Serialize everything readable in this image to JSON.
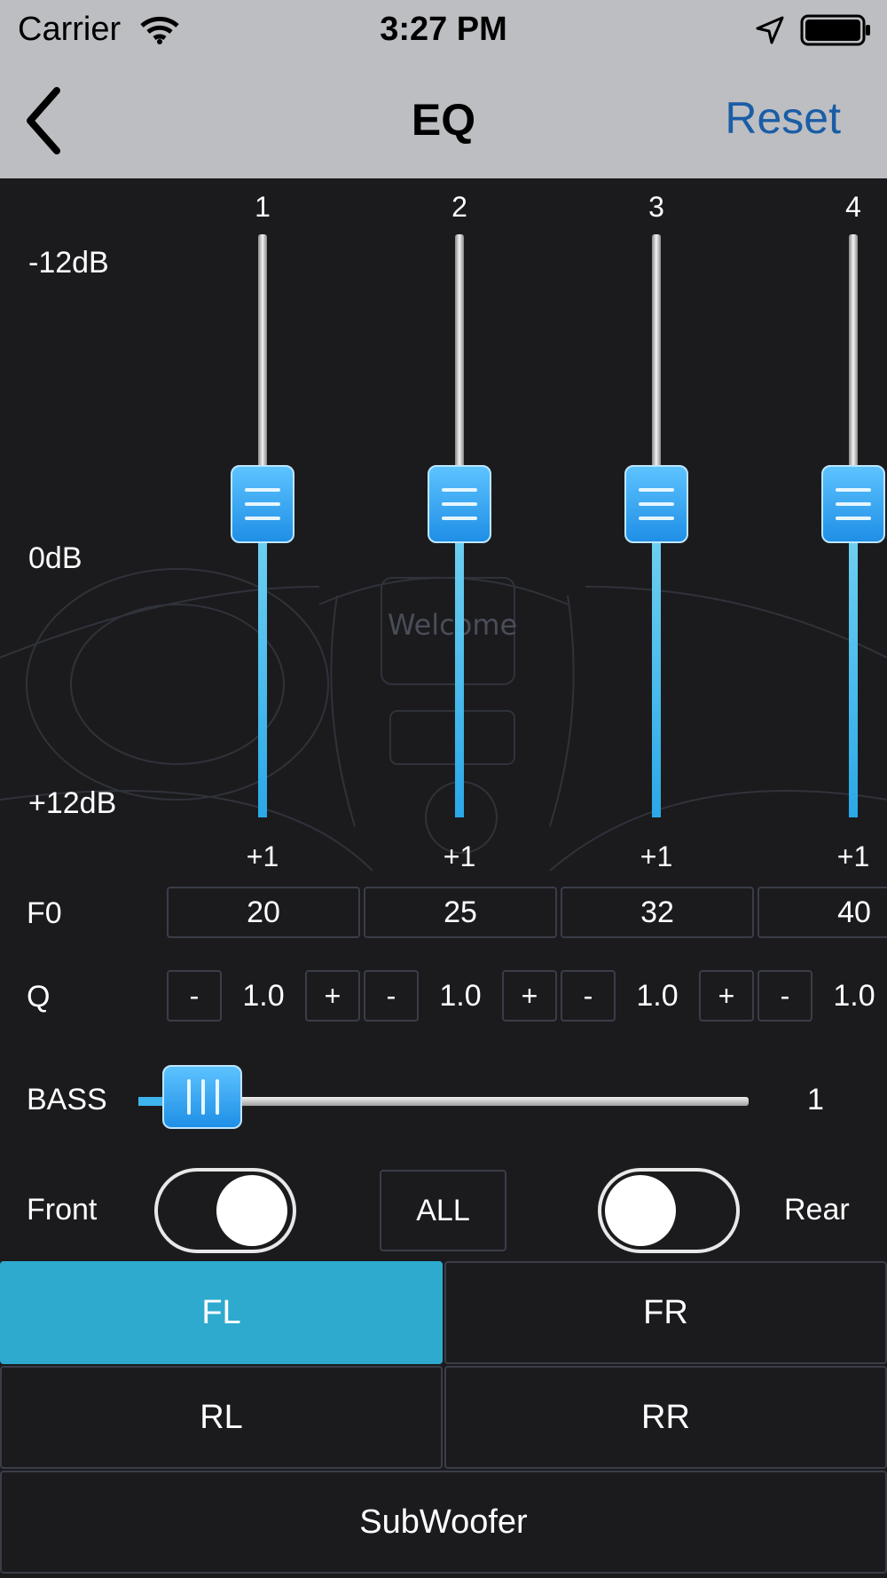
{
  "status_bar": {
    "carrier": "Carrier",
    "time": "3:27 PM",
    "icons": [
      "wifi-icon",
      "location-icon",
      "battery-icon"
    ]
  },
  "nav": {
    "title": "EQ",
    "reset_label": "Reset",
    "back_icon": "chevron-left-icon"
  },
  "db_labels": {
    "top": "-12dB",
    "mid": "0dB",
    "bottom": "+12dB"
  },
  "bands": [
    {
      "number": "1",
      "gain": "+1",
      "f0": "20",
      "q": "1.0"
    },
    {
      "number": "2",
      "gain": "+1",
      "f0": "25",
      "q": "1.0"
    },
    {
      "number": "3",
      "gain": "+1",
      "f0": "32",
      "q": "1.0"
    },
    {
      "number": "4",
      "gain": "+1",
      "f0": "40",
      "q": "1.0"
    }
  ],
  "q_controls": {
    "minus": "-",
    "plus": "+"
  },
  "rows": {
    "f0_label": "F0",
    "q_label": "Q"
  },
  "bass": {
    "label": "BASS",
    "value": "1"
  },
  "fader": {
    "front_label": "Front",
    "all_label": "ALL",
    "rear_label": "Rear",
    "front_on": true,
    "rear_on": false
  },
  "watermark_text": "Welcome",
  "channels": [
    {
      "label": "FL",
      "active": true
    },
    {
      "label": "FR",
      "active": false
    },
    {
      "label": "RL",
      "active": false
    },
    {
      "label": "RR",
      "active": false
    },
    {
      "label": "SubWoofer",
      "active": false
    }
  ],
  "colors": {
    "accent": "#2eaacf",
    "slider_blue": "#2aa8e8",
    "reset_link": "#1a5da6",
    "background": "#1b1b1e",
    "nav_background": "#bdbec2"
  }
}
